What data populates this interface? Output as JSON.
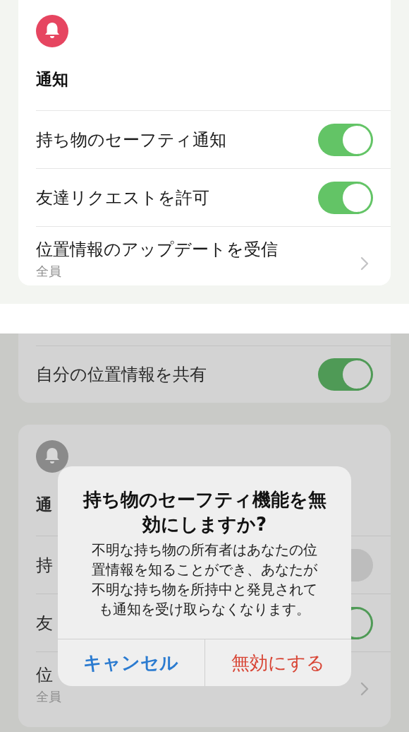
{
  "top_screen": {
    "section": {
      "title": "通知",
      "rows": [
        {
          "kind": "toggle",
          "label": "持ち物のセーフティ通知",
          "on": true
        },
        {
          "kind": "toggle",
          "label": "友達リクエストを許可",
          "on": true
        },
        {
          "kind": "link",
          "label": "位置情報のアップデートを受信",
          "value": "全員"
        }
      ]
    }
  },
  "bottom_screen": {
    "location_section": {
      "rows": [
        {
          "kind": "toggle",
          "label": "自分の位置情報を共有",
          "on": true
        }
      ]
    },
    "notification_section": {
      "title": "通",
      "rows": [
        {
          "kind": "toggle",
          "label": "持",
          "on": false
        },
        {
          "kind": "toggle",
          "label": "友",
          "on": true
        },
        {
          "kind": "link",
          "label": "位",
          "value": "全員"
        }
      ]
    },
    "alert": {
      "title": "持ち物のセーフティ機能を無効にしますか?",
      "message": "不明な持ち物の所有者はあなたの位置情報を知ることができ、あなたが不明な持ち物を所持中と発見されても通知を受け取らなくなります。",
      "buttons": [
        {
          "kind": "cancel",
          "label": "キャンセル"
        },
        {
          "kind": "destructive",
          "label": "無効にする"
        }
      ]
    }
  }
}
